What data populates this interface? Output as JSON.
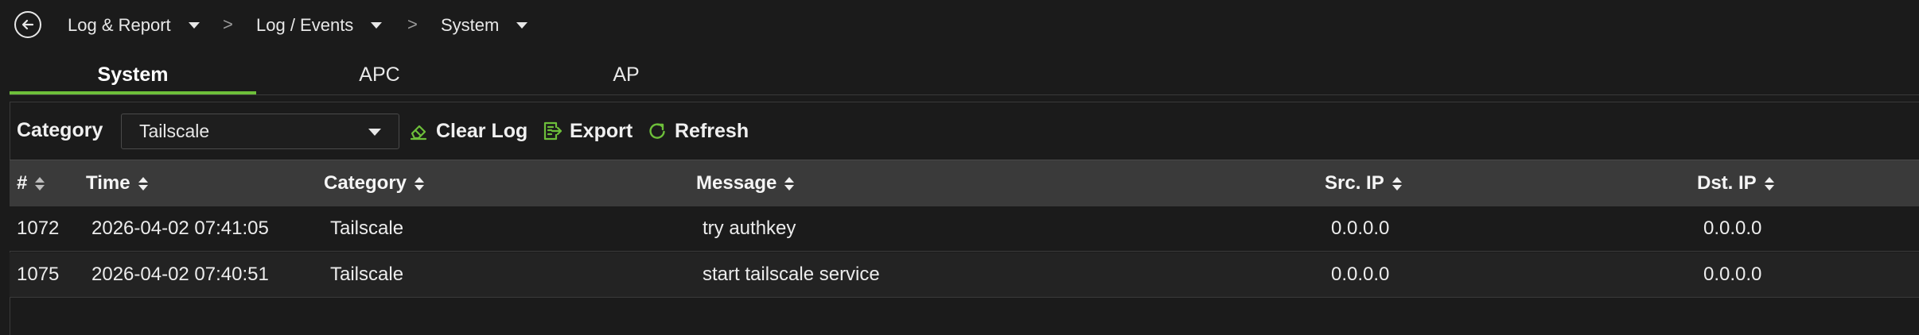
{
  "breadcrumb": {
    "items": [
      "Log & Report",
      "Log / Events",
      "System"
    ],
    "separator": ">"
  },
  "tabs": [
    "System",
    "APC",
    "AP"
  ],
  "active_tab": "System",
  "toolbar": {
    "category_label": "Category",
    "category_value": "Tailscale",
    "clear_log_label": "Clear Log",
    "export_label": "Export",
    "refresh_label": "Refresh"
  },
  "table": {
    "columns": [
      "#",
      "Time",
      "Category",
      "Message",
      "Src. IP",
      "Dst. IP"
    ],
    "rows": [
      [
        "1072",
        "2026-04-02 07:41:05",
        "Tailscale",
        "try authkey",
        "0.0.0.0",
        "0.0.0.0"
      ],
      [
        "1075",
        "2026-04-02 07:40:51",
        "Tailscale",
        "start tailscale service",
        "0.0.0.0",
        "0.0.0.0"
      ]
    ]
  },
  "colors": {
    "accent": "#6dbf3a",
    "background": "#1b1b1b",
    "header_bg": "#3a3a3a"
  },
  "icons": {
    "back": "arrow-left-circle-icon",
    "clear_log": "eraser-icon",
    "export": "export-file-icon",
    "refresh": "refresh-icon"
  }
}
